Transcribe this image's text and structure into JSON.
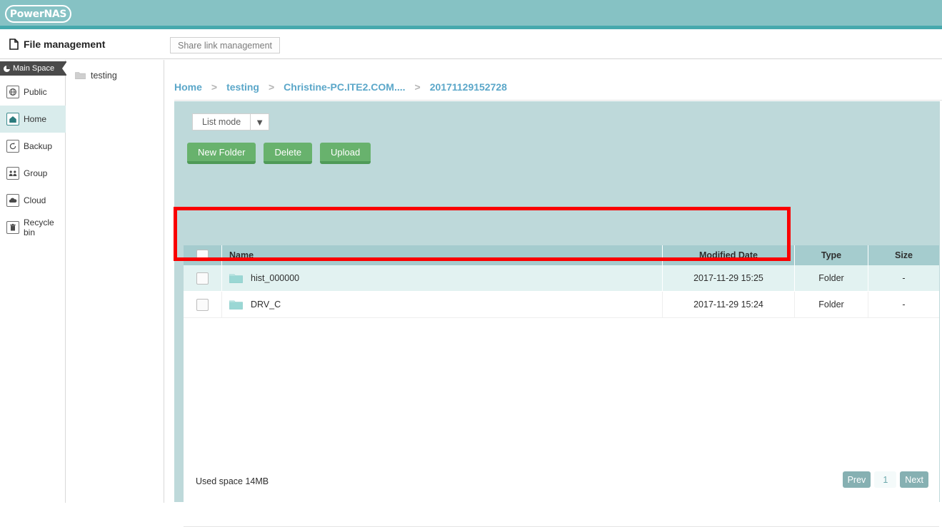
{
  "brand": {
    "logo_text": "PowerNAS"
  },
  "header": {
    "title": "File management",
    "doc_icon": "document-icon",
    "tabs": [
      {
        "label": "Share link management"
      }
    ]
  },
  "sidebar": {
    "section_label": "Main Space",
    "section_icon": "pie-icon",
    "items": [
      {
        "label": "Public",
        "icon": "globe-icon",
        "active": false
      },
      {
        "label": "Home",
        "icon": "home-icon",
        "active": true
      },
      {
        "label": "Backup",
        "icon": "restore-icon",
        "active": false
      },
      {
        "label": "Group",
        "icon": "group-icon",
        "active": false
      },
      {
        "label": "Cloud",
        "icon": "cloud-icon",
        "active": false
      },
      {
        "label": "Recycle bin",
        "icon": "trash-icon",
        "active": false
      }
    ]
  },
  "tree": {
    "items": [
      {
        "label": "testing",
        "icon": "folder-icon"
      }
    ]
  },
  "breadcrumb": {
    "separator": ">",
    "items": [
      {
        "label": "Home"
      },
      {
        "label": "testing"
      },
      {
        "label": "Christine-PC.ITE2.COM...."
      },
      {
        "label": "20171129152728"
      }
    ]
  },
  "toolbar": {
    "view_mode": "List mode",
    "view_mode_caret": "chevron-down-icon",
    "new_folder_label": "New Folder",
    "delete_label": "Delete",
    "upload_label": "Upload"
  },
  "table": {
    "columns": [
      "",
      "Name",
      "Modified Date",
      "Type",
      "Size"
    ],
    "rows": [
      {
        "name": "hist_000000",
        "modified": "2017-11-29 15:25",
        "type": "Folder",
        "size": "-",
        "icon": "folder-icon",
        "checked": false
      },
      {
        "name": "DRV_C",
        "modified": "2017-11-29 15:24",
        "type": "Folder",
        "size": "-",
        "icon": "folder-icon",
        "checked": false
      }
    ]
  },
  "footer": {
    "used_space": "Used space 14MB",
    "pager": {
      "prev": "Prev",
      "page": "1",
      "next": "Next"
    }
  },
  "colors": {
    "brand_teal": "#86c2c4",
    "brand_teal_dark": "#46a9ad",
    "panel_bg": "#bed9da",
    "table_header": "#a5ccce",
    "row_alt": "#e2f2f1",
    "green_button": "#68b26d",
    "green_button_shadow": "#4f9a57",
    "link_blue": "#5ba7c9",
    "highlight_red": "#f90000",
    "active_nav": "#d9ecec"
  }
}
